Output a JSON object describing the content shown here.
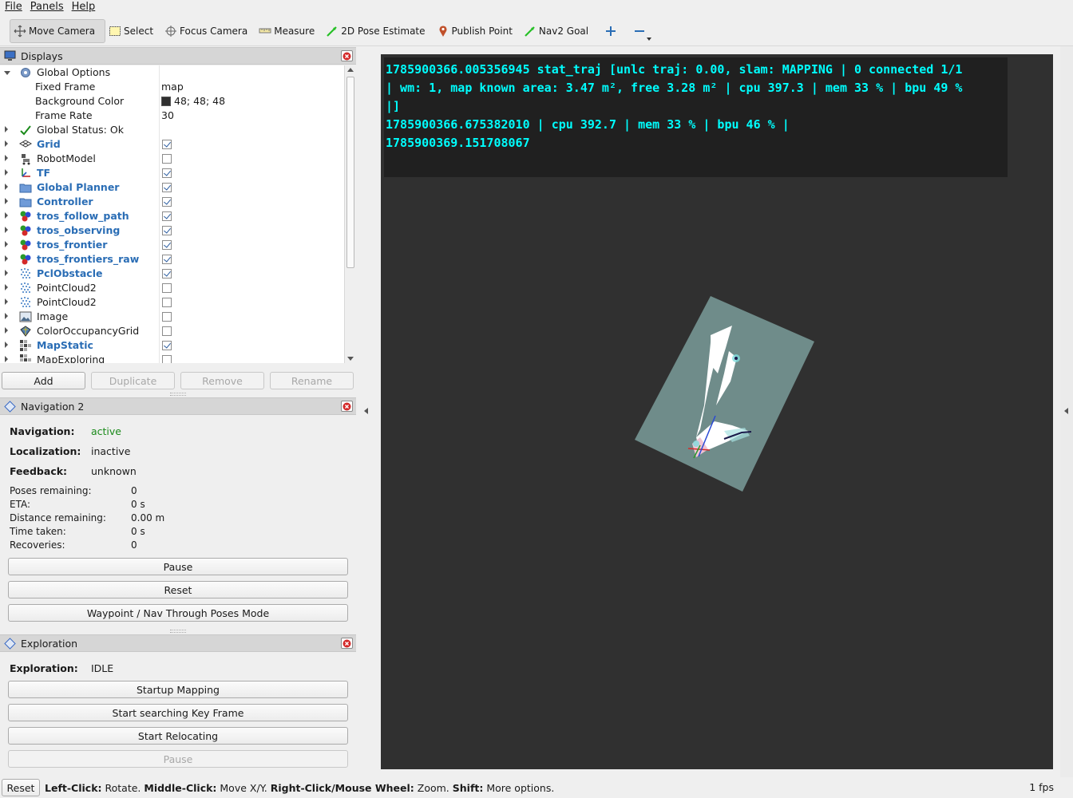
{
  "menubar": {
    "items": [
      "File",
      "Panels",
      "Help"
    ]
  },
  "toolbar": {
    "tools": [
      {
        "label": "Move Camera",
        "active": true,
        "icon": "move-camera-icon"
      },
      {
        "label": "Select",
        "icon": "select-icon"
      },
      {
        "label": "Focus Camera",
        "icon": "focus-camera-icon"
      },
      {
        "label": "Measure",
        "icon": "measure-icon"
      },
      {
        "label": "2D Pose Estimate",
        "icon": "pose-estimate-icon"
      },
      {
        "label": "Publish Point",
        "icon": "publish-point-icon"
      },
      {
        "label": "Nav2 Goal",
        "icon": "nav2-goal-icon"
      }
    ]
  },
  "displays": {
    "title": "Displays",
    "global_options": "Global Options",
    "props": [
      {
        "name": "Fixed Frame",
        "value": "map"
      },
      {
        "name": "Background Color",
        "value": "48; 48; 48"
      },
      {
        "name": "Frame Rate",
        "value": "30"
      }
    ],
    "global_status": "Global Status: Ok",
    "items": [
      {
        "label": "Grid",
        "checked": true,
        "bold": true
      },
      {
        "label": "RobotModel",
        "checked": false,
        "bold": false
      },
      {
        "label": "TF",
        "checked": true,
        "bold": true
      },
      {
        "label": "Global Planner",
        "checked": true,
        "bold": true
      },
      {
        "label": "Controller",
        "checked": true,
        "bold": true
      },
      {
        "label": "tros_follow_path",
        "checked": true,
        "bold": true
      },
      {
        "label": "tros_observing",
        "checked": true,
        "bold": true
      },
      {
        "label": "tros_frontier",
        "checked": true,
        "bold": true
      },
      {
        "label": "tros_frontiers_raw",
        "checked": true,
        "bold": true
      },
      {
        "label": "PclObstacle",
        "checked": true,
        "bold": true
      },
      {
        "label": "PointCloud2",
        "checked": false,
        "bold": false
      },
      {
        "label": "PointCloud2",
        "checked": false,
        "bold": false
      },
      {
        "label": "Image",
        "checked": false,
        "bold": false
      },
      {
        "label": "ColorOccupancyGrid",
        "checked": false,
        "bold": false
      },
      {
        "label": "MapStatic",
        "checked": true,
        "bold": true
      },
      {
        "label": "MapExploring",
        "checked": false,
        "bold": false
      }
    ],
    "buttons": {
      "add": "Add",
      "duplicate": "Duplicate",
      "remove": "Remove",
      "rename": "Rename"
    }
  },
  "navigation": {
    "title": "Navigation 2",
    "navigation_label": "Navigation:",
    "navigation_value": "active",
    "localization_label": "Localization:",
    "localization_value": "inactive",
    "feedback_label": "Feedback:",
    "feedback_value": "unknown",
    "stats": [
      {
        "label": "Poses remaining:",
        "value": "0"
      },
      {
        "label": "ETA:",
        "value": "0 s"
      },
      {
        "label": "Distance remaining:",
        "value": "0.00 m"
      },
      {
        "label": "Time taken:",
        "value": "0 s"
      },
      {
        "label": "Recoveries:",
        "value": "0"
      }
    ],
    "buttons": {
      "pause": "Pause",
      "reset": "Reset",
      "mode": "Waypoint / Nav Through Poses Mode"
    }
  },
  "exploration": {
    "title": "Exploration",
    "label": "Exploration:",
    "value": "IDLE",
    "buttons": {
      "startup": "Startup Mapping",
      "keyframe": "Start searching Key Frame",
      "relocating": "Start Relocating",
      "pause": "Pause"
    }
  },
  "overlay": {
    "lines": [
      "1785900366.005356945 stat_traj [unlc traj: 0.00, slam: MAPPING | 0 connected 1/1",
      "| wm: 1, map known area: 3.47 m², free 3.28 m² | cpu 397.3 | mem 33 % | bpu 49 %",
      "|]",
      "1785900366.675382010 | cpu 392.7 | mem 33 % | bpu 46 % |",
      "1785900369.151708067"
    ]
  },
  "statusbar": {
    "reset": "Reset",
    "left_click": "Left-Click:",
    "left_click_desc": " Rotate. ",
    "middle_click": "Middle-Click:",
    "middle_click_desc": " Move X/Y. ",
    "right_click": "Right-Click/Mouse Wheel:",
    "right_click_desc": " Zoom. ",
    "shift": "Shift:",
    "shift_desc": " More options.",
    "fps": "1 fps"
  },
  "colors": {
    "view_bg": "#303030",
    "overlay_text": "#00ffff",
    "map_fill": "#6f8c8a",
    "active_green": "#1a8a1a",
    "bold_item": "#2a6db5"
  }
}
